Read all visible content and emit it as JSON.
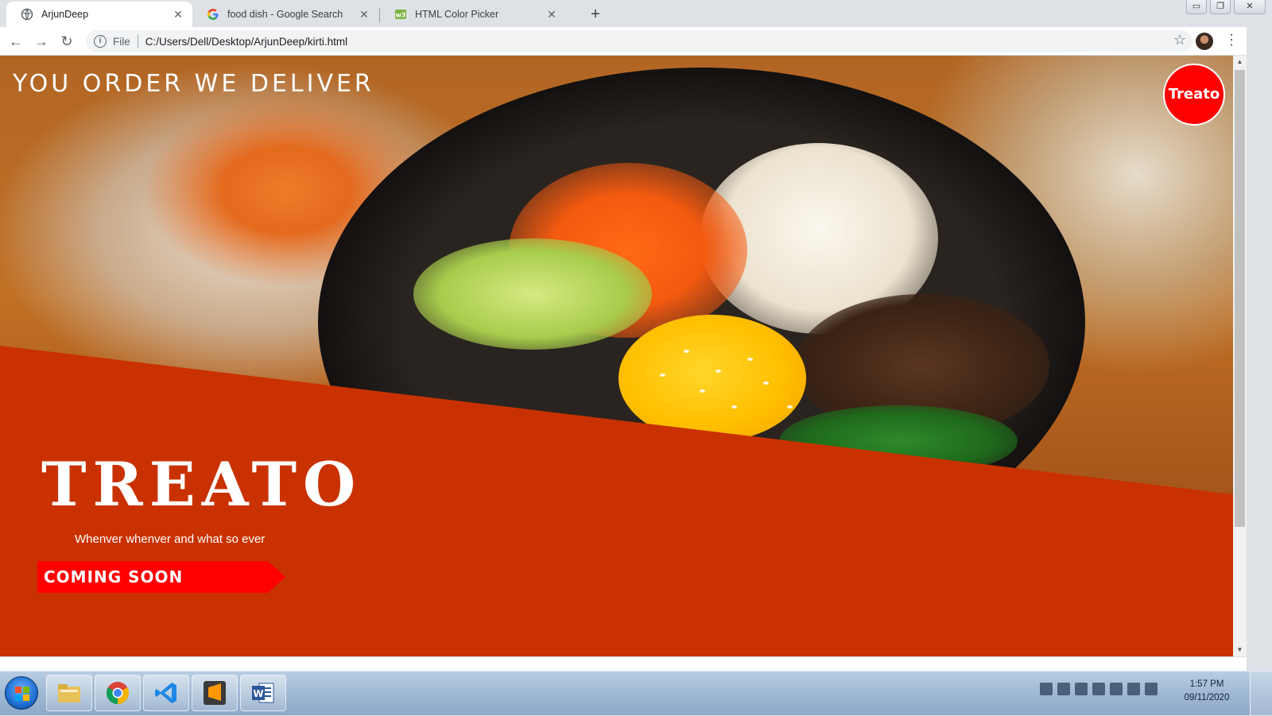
{
  "browser": {
    "tabs": [
      {
        "label": "ArjunDeep",
        "icon": "globe-icon",
        "active": true
      },
      {
        "label": "food dish - Google Search",
        "icon": "google-icon",
        "active": false
      },
      {
        "label": "HTML Color Picker",
        "icon": "color-picker-icon",
        "active": false
      }
    ],
    "address": {
      "scheme": "File",
      "url": "C:/Users/Dell/Desktop/ArjunDeep/kirti.html"
    }
  },
  "page": {
    "tagline": "YOU ORDER WE DELIVER",
    "badge": "Treato",
    "brand": "TREATO",
    "subtitle": "Whenver whenver and what so ever",
    "cta": "COMING SOON",
    "colors": {
      "band": "#c93200",
      "badge": "#ff0000",
      "cta": "#ff0000",
      "text": "#ffffff"
    }
  },
  "taskbar": {
    "apps": [
      "file-explorer-icon",
      "chrome-icon",
      "vscode-icon",
      "sublime-text-icon",
      "word-icon"
    ],
    "time": "1:57 PM",
    "date": "09/11/2020"
  }
}
